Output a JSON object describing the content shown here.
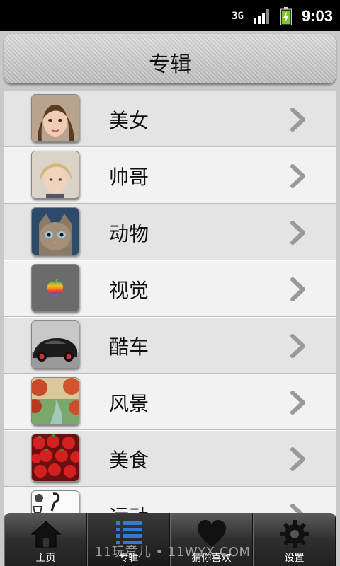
{
  "status_bar": {
    "network": "3G",
    "time": "9:03",
    "icons": [
      "signal-icon",
      "battery-icon"
    ]
  },
  "header": {
    "title": "专辑"
  },
  "albums": [
    {
      "label": "美女",
      "thumb": "portrait-woman"
    },
    {
      "label": "帅哥",
      "thumb": "portrait-man"
    },
    {
      "label": "动物",
      "thumb": "kitten"
    },
    {
      "label": "视觉",
      "thumb": "apple-logo"
    },
    {
      "label": "酷车",
      "thumb": "sports-car"
    },
    {
      "label": "风景",
      "thumb": "landscape"
    },
    {
      "label": "美食",
      "thumb": "strawberries"
    },
    {
      "label": "运动",
      "thumb": "basketball"
    }
  ],
  "tabs": [
    {
      "label": "主页",
      "icon": "home-icon"
    },
    {
      "label": "专辑",
      "icon": "list-icon",
      "active": true
    },
    {
      "label": "猜你喜欢",
      "icon": "heart-icon"
    },
    {
      "label": "设置",
      "icon": "gear-icon"
    }
  ],
  "watermark": "11玩意儿 • 11WYX.COM"
}
